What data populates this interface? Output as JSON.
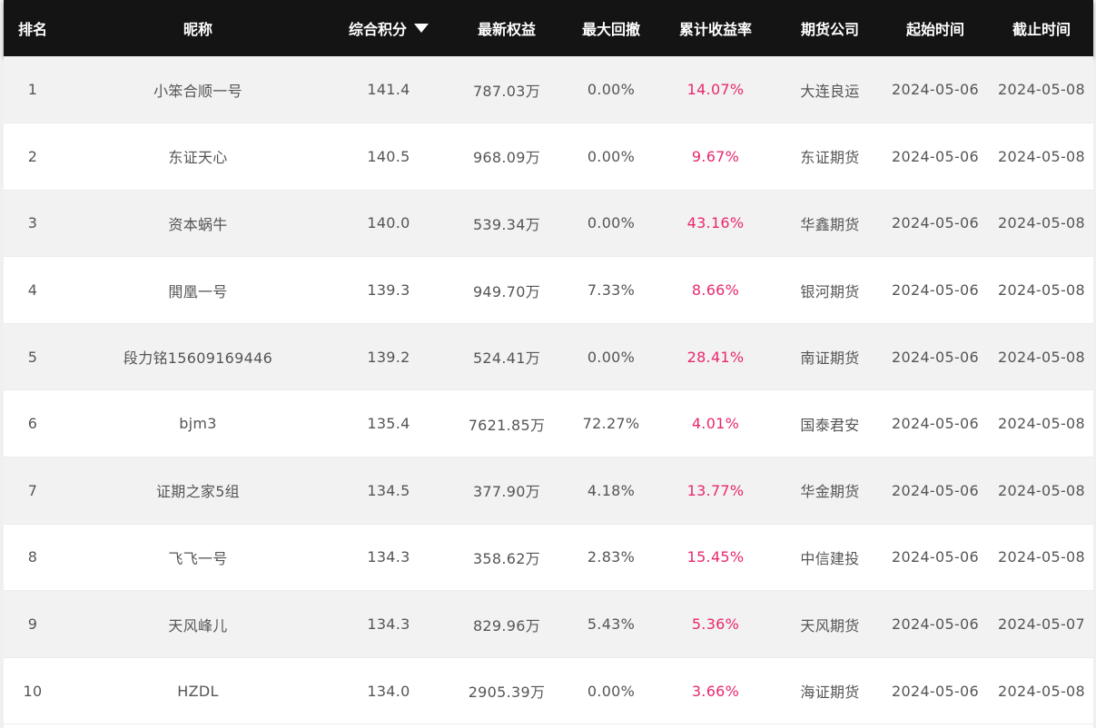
{
  "colors": {
    "header_bg": "#141414",
    "header_text": "#ffffff",
    "cell_text": "#555555",
    "rate_text": "#e8286e",
    "row_alt_bg": "#f2f2f2"
  },
  "header": {
    "rank": "排名",
    "nickname": "昵称",
    "score": "综合积分",
    "score_sort_icon": "triangle-down-icon",
    "equity": "最新权益",
    "drawdown": "最大回撤",
    "return_rate": "累计收益率",
    "broker": "期货公司",
    "start": "起始时间",
    "end": "截止时间"
  },
  "rows": [
    {
      "rank": "1",
      "nickname": "小笨合顺一号",
      "score": "141.4",
      "equity": "787.03万",
      "drawdown": "0.00%",
      "return_rate": "14.07%",
      "broker": "大连良运",
      "start": "2024-05-06",
      "end": "2024-05-08"
    },
    {
      "rank": "2",
      "nickname": "东证天心",
      "score": "140.5",
      "equity": "968.09万",
      "drawdown": "0.00%",
      "return_rate": "9.67%",
      "broker": "东证期货",
      "start": "2024-05-06",
      "end": "2024-05-08"
    },
    {
      "rank": "3",
      "nickname": "资本蜗牛",
      "score": "140.0",
      "equity": "539.34万",
      "drawdown": "0.00%",
      "return_rate": "43.16%",
      "broker": "华鑫期货",
      "start": "2024-05-06",
      "end": "2024-05-08"
    },
    {
      "rank": "4",
      "nickname": "閧凰一号",
      "score": "139.3",
      "equity": "949.70万",
      "drawdown": "7.33%",
      "return_rate": "8.66%",
      "broker": "银河期货",
      "start": "2024-05-06",
      "end": "2024-05-08"
    },
    {
      "rank": "5",
      "nickname": "段力铭15609169446",
      "score": "139.2",
      "equity": "524.41万",
      "drawdown": "0.00%",
      "return_rate": "28.41%",
      "broker": "南证期货",
      "start": "2024-05-06",
      "end": "2024-05-08"
    },
    {
      "rank": "6",
      "nickname": "bjm3",
      "score": "135.4",
      "equity": "7621.85万",
      "drawdown": "72.27%",
      "return_rate": "4.01%",
      "broker": "国泰君安",
      "start": "2024-05-06",
      "end": "2024-05-08"
    },
    {
      "rank": "7",
      "nickname": "证期之家5组",
      "score": "134.5",
      "equity": "377.90万",
      "drawdown": "4.18%",
      "return_rate": "13.77%",
      "broker": "华金期货",
      "start": "2024-05-06",
      "end": "2024-05-08"
    },
    {
      "rank": "8",
      "nickname": "飞飞一号",
      "score": "134.3",
      "equity": "358.62万",
      "drawdown": "2.83%",
      "return_rate": "15.45%",
      "broker": "中信建投",
      "start": "2024-05-06",
      "end": "2024-05-08"
    },
    {
      "rank": "9",
      "nickname": "天风峰儿",
      "score": "134.3",
      "equity": "829.96万",
      "drawdown": "5.43%",
      "return_rate": "5.36%",
      "broker": "天风期货",
      "start": "2024-05-06",
      "end": "2024-05-07"
    },
    {
      "rank": "10",
      "nickname": "HZDL",
      "score": "134.0",
      "equity": "2905.39万",
      "drawdown": "0.00%",
      "return_rate": "3.66%",
      "broker": "海证期货",
      "start": "2024-05-06",
      "end": "2024-05-08"
    }
  ]
}
